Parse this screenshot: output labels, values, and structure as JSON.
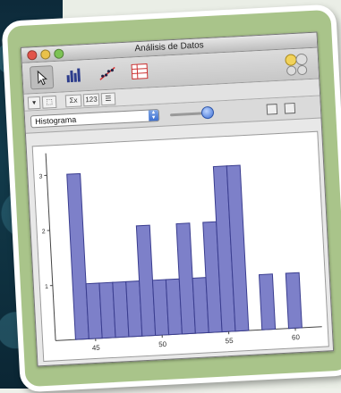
{
  "window": {
    "title": "Análisis de Datos"
  },
  "toolbar": {
    "tools": [
      "pointer-tool",
      "bar-chart-tool",
      "scatter-tool",
      "table-tool"
    ]
  },
  "subbar": {
    "buttons": [
      "▾",
      "⬚",
      "Σx",
      "123",
      "☰"
    ]
  },
  "controls": {
    "chart_type": "Histograma",
    "slider_value": 0.9
  },
  "chart_data": {
    "type": "bar",
    "x": [
      44,
      45,
      46,
      47,
      48,
      49,
      50,
      51,
      52,
      53,
      54,
      55,
      56,
      57,
      58,
      59,
      60
    ],
    "values": [
      3,
      1,
      1,
      1,
      1,
      2,
      1,
      1,
      2,
      1,
      2,
      3,
      3,
      0,
      1,
      0,
      1
    ],
    "xticks": [
      "45",
      "50",
      "55",
      "60"
    ],
    "xtick_values": [
      45,
      50,
      55,
      60
    ],
    "yticks": [
      "1",
      "2",
      "3"
    ],
    "ytick_values": [
      1,
      2,
      3
    ],
    "xlim": [
      42,
      62
    ],
    "ylim": [
      0,
      3.4
    ],
    "bar_color": "#7d80c9",
    "bar_edge": "#3a3d8f"
  }
}
